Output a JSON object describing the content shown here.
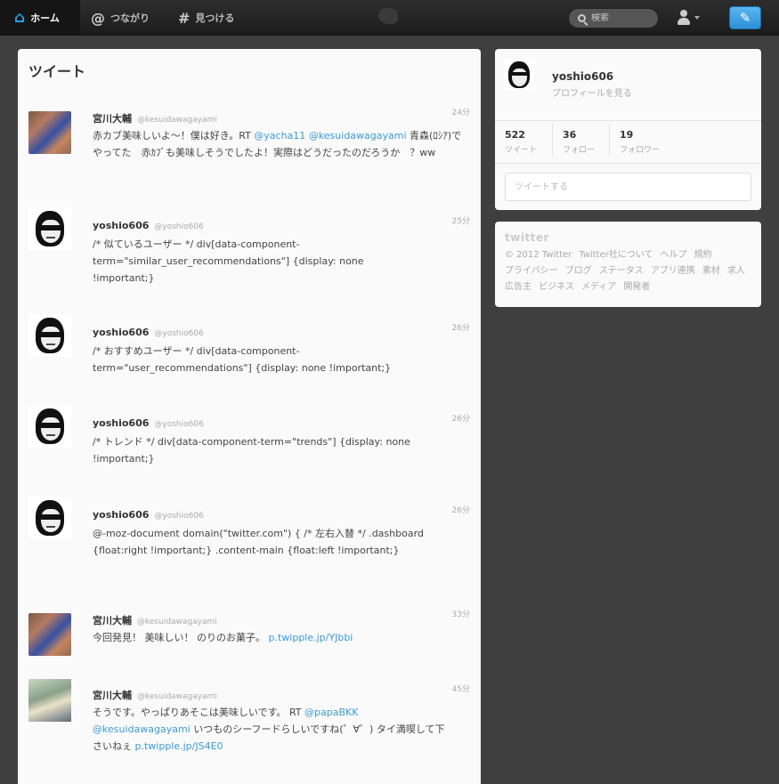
{
  "nav": {
    "home": "ホーム",
    "connect": "つながり",
    "discover": "見つける",
    "search_placeholder": "検索"
  },
  "timeline": {
    "title": "ツイート",
    "tweets": [
      {
        "name": "宮川大輔",
        "handle": "@kesuidawagayami",
        "time": "24分",
        "avatar": "photo",
        "text_parts": [
          "赤カブ美味しいよ～！僕は好き。RT ",
          "@yacha11",
          " ",
          "@kesuidawagayami",
          " 青森(ﾛｼｱ)でやってた　赤ｶﾌﾞも美味しそうでしたよ！実際はどうだったのだろうか　？ww"
        ]
      },
      {
        "name": "yoshio606",
        "handle": "@yoshio606",
        "time": "25分",
        "avatar": "face",
        "text": "/* 似ているユーザー */ div[data-component-term=\"similar_user_recommendations\"] {display: none !important;}"
      },
      {
        "name": "yoshio606",
        "handle": "@yoshio606",
        "time": "26分",
        "avatar": "face",
        "text": "/* おすすめユーザー */ div[data-component-term=\"user_recommendations\"] {display: none !important;}"
      },
      {
        "name": "yoshio606",
        "handle": "@yoshio606",
        "time": "26分",
        "avatar": "face",
        "text": "/* トレンド */ div[data-component-term=\"trends\"] {display: none !important;}"
      },
      {
        "name": "yoshio606",
        "handle": "@yoshio606",
        "time": "26分",
        "avatar": "face",
        "text": "@-moz-document domain(\"twitter.com\") { /* 左右入替 */ .dashboard {float:right !important;} .content-main {float:left !important;}"
      },
      {
        "name": "宮川大輔",
        "handle": "@kesuidawagayami",
        "time": "33分",
        "avatar": "photo",
        "text_parts": [
          "今回発見！ 美味しい！ のりのお菓子。 ",
          "p.twipple.jp/YJbbi"
        ]
      },
      {
        "name": "宮川大輔",
        "handle": "@kesuidawagayami",
        "time": "45分",
        "avatar": "group",
        "text_parts": [
          "そうです。やっぱりあそこは美味しいです。 RT ",
          "@papaBKK",
          " ",
          "@kesuidawagayami",
          " いつものシーフードらしいですね(゜∀゜) タイ満喫して下さいねぇ ",
          "p.twipple.jp/JS4E0"
        ]
      }
    ]
  },
  "profile": {
    "name": "yoshio606",
    "link": "プロフィールを見る",
    "stats": [
      {
        "num": "522",
        "label": "ツイート"
      },
      {
        "num": "36",
        "label": "フォロー"
      },
      {
        "num": "19",
        "label": "フォロワー"
      }
    ],
    "tweet_placeholder": "ツイートする"
  },
  "footer": {
    "logo": "twitter",
    "links": [
      "© 2012 Twitter",
      "Twitter社について",
      "ヘルプ",
      "規約",
      "プライバシー",
      "ブログ",
      "ステータス",
      "アプリ連携",
      "素材",
      "求人",
      "広告主",
      "ビジネス",
      "メディア",
      "開発者"
    ]
  },
  "colors": {
    "link": "#3a9ad9",
    "accent": "#2a9ee3"
  }
}
